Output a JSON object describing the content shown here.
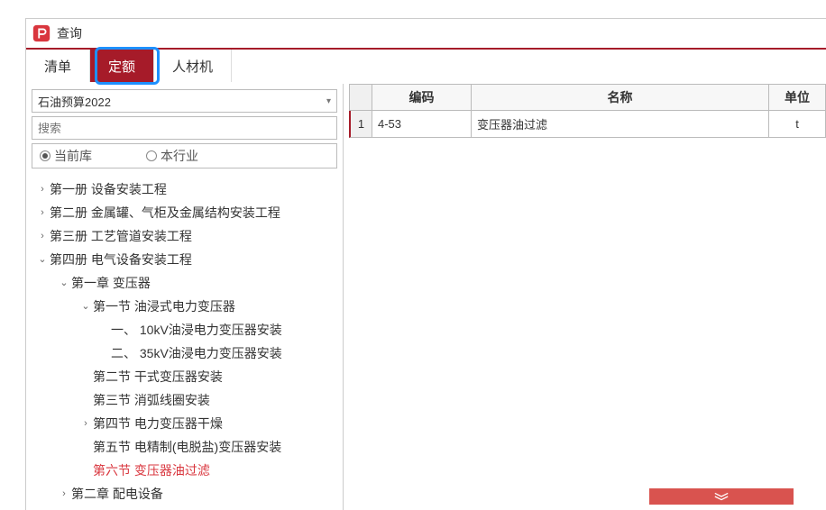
{
  "window": {
    "title": "查询"
  },
  "tabs": {
    "list": "清单",
    "quota": "定额",
    "labor": "人材机"
  },
  "combo": {
    "value": "石油预算2022"
  },
  "search": {
    "placeholder": "搜索"
  },
  "radios": {
    "current": "当前库",
    "industry": "本行业"
  },
  "tree": {
    "b1": "第一册 设备安装工程",
    "b2": "第二册 金属罐、气柜及金属结构安装工程",
    "b3": "第三册 工艺管道安装工程",
    "b4": "第四册 电气设备安装工程",
    "c1": "第一章 变压器",
    "s1": "第一节 油浸式电力变压器",
    "s1a": "一、 10kV油浸电力变压器安装",
    "s1b": "二、 35kV油浸电力变压器安装",
    "s2": "第二节 干式变压器安装",
    "s3": "第三节 消弧线圈安装",
    "s4": "第四节 电力变压器干燥",
    "s5": "第五节 电精制(电脱盐)变压器安装",
    "s6": "第六节 变压器油过滤",
    "c2": "第二章 配电设备"
  },
  "grid": {
    "headers": {
      "code": "编码",
      "name": "名称",
      "unit": "单位"
    },
    "rows": [
      {
        "num": "1",
        "code": "4-53",
        "name": "变压器油过滤",
        "unit": "t"
      }
    ]
  }
}
